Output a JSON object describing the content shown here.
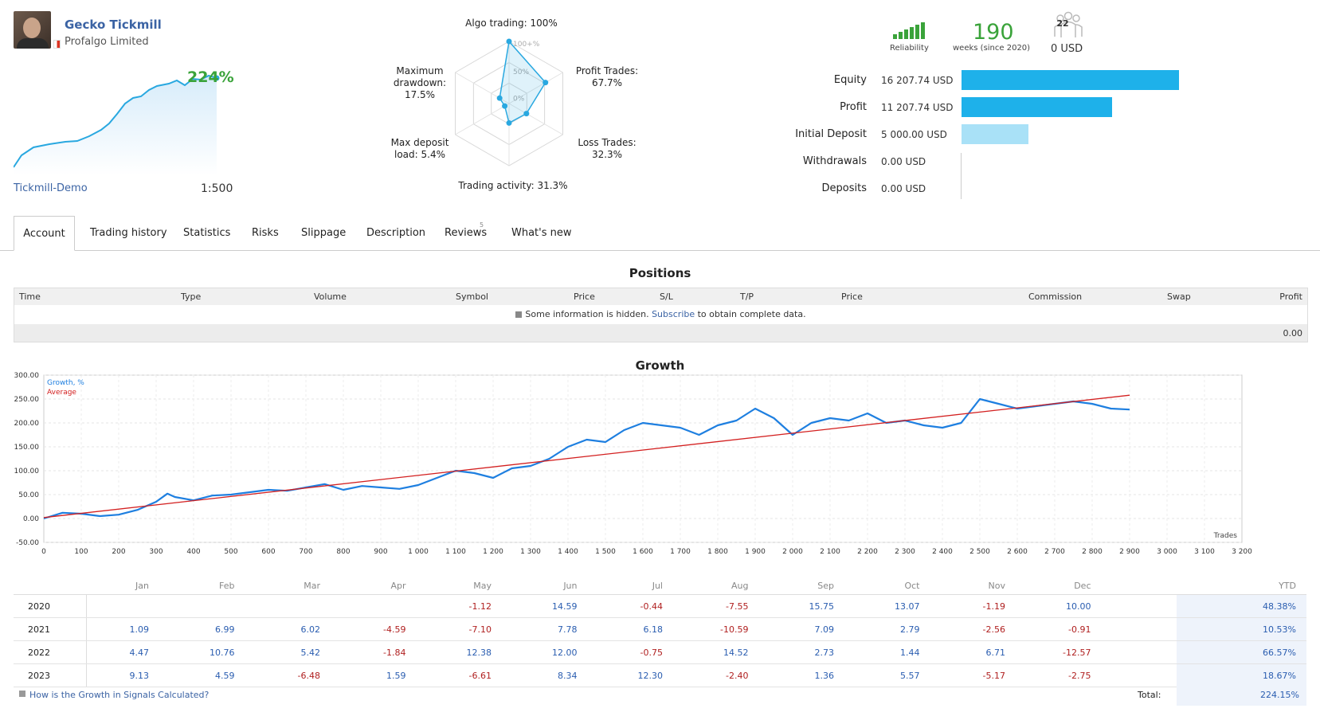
{
  "profile": {
    "name": "Gecko Tickmill",
    "company": "Profalgo Limited",
    "growth": "224%",
    "server": "Tickmill-Demo",
    "leverage": "1:500"
  },
  "radar": {
    "labels": {
      "algo": "Algo trading: 100%",
      "profit_trades": "Profit Trades:\n67.7%",
      "loss_trades": "Loss Trades:\n32.3%",
      "activity": "Trading activity: 31.3%",
      "deposit_load": "Max deposit\nload: 5.4%",
      "drawdown": "Maximum\ndrawdown:\n17.5%"
    },
    "scale": [
      "100+%",
      "50%",
      "0%"
    ],
    "values": {
      "algo": 100,
      "profit_trades": 67.7,
      "loss_trades": 32.3,
      "activity": 31.3,
      "deposit_load": 5.4,
      "drawdown": 17.5
    }
  },
  "summary": {
    "reliability_label": "Reliability",
    "reliability_level": 5,
    "weeks": "190",
    "weeks_label": "weeks (since 2020)",
    "subscribers": "22",
    "subscription_price": "0 USD"
  },
  "stats": [
    {
      "label": "Equity",
      "value": "16 207.74 USD",
      "amount": 16207.74,
      "color": "#1eb1ea"
    },
    {
      "label": "Profit",
      "value": "11 207.74 USD",
      "amount": 11207.74,
      "color": "#1eb1ea"
    },
    {
      "label": "Initial Deposit",
      "value": "5 000.00 USD",
      "amount": 5000,
      "color": "#a9e1f7"
    },
    {
      "label": "Withdrawals",
      "value": "0.00 USD",
      "amount": 0,
      "color": "#1eb1ea"
    },
    {
      "label": "Deposits",
      "value": "0.00 USD",
      "amount": 0,
      "color": "#1eb1ea"
    }
  ],
  "tabs": [
    "Account",
    "Trading history",
    "Statistics",
    "Risks",
    "Slippage",
    "Description",
    "Reviews",
    "What's new"
  ],
  "reviews_count": "5",
  "positions": {
    "title": "Positions",
    "columns": [
      "Time",
      "Type",
      "Volume",
      "Symbol",
      "Price",
      "S/L",
      "T/P",
      "Price",
      "Commission",
      "Swap",
      "Profit"
    ],
    "hidden_text_before": "Some information is hidden. ",
    "subscribe_link": "Subscribe",
    "hidden_text_after": " to obtain complete data.",
    "total": "0.00"
  },
  "chart_data": {
    "type": "line",
    "title": "Growth",
    "legend": [
      "Growth, %",
      "Average"
    ],
    "xlabel": "Trades",
    "ylim": [
      -50,
      300
    ],
    "xlim": [
      0,
      3200
    ],
    "yticks": [
      "300.00",
      "250.00",
      "200.00",
      "150.00",
      "100.00",
      "50.00",
      "0.00",
      "-50.00"
    ],
    "xticks": [
      "0",
      "100",
      "200",
      "300",
      "400",
      "500",
      "600",
      "700",
      "800",
      "900",
      "1 000",
      "1 100",
      "1 200",
      "1 300",
      "1 400",
      "1 500",
      "1 600",
      "1 700",
      "1 800",
      "1 900",
      "2 000",
      "2 100",
      "2 200",
      "2 300",
      "2 400",
      "2 500",
      "2 600",
      "2 700",
      "2 800",
      "2 900",
      "3 000",
      "3 100",
      "3 200"
    ],
    "series": [
      {
        "name": "Growth, %",
        "color": "#1e7fe0",
        "x": [
          0,
          50,
          100,
          150,
          200,
          250,
          300,
          330,
          350,
          400,
          450,
          500,
          550,
          600,
          650,
          700,
          750,
          800,
          850,
          900,
          950,
          1000,
          1050,
          1100,
          1150,
          1200,
          1250,
          1300,
          1350,
          1400,
          1450,
          1500,
          1550,
          1600,
          1650,
          1700,
          1750,
          1800,
          1850,
          1900,
          1950,
          2000,
          2050,
          2100,
          2150,
          2200,
          2250,
          2300,
          2350,
          2400,
          2450,
          2500,
          2550,
          2600,
          2650,
          2700,
          2750,
          2800,
          2850,
          2900
        ],
        "y": [
          0,
          12,
          10,
          5,
          8,
          18,
          35,
          52,
          45,
          38,
          48,
          50,
          55,
          60,
          58,
          65,
          72,
          60,
          68,
          65,
          62,
          70,
          85,
          100,
          95,
          85,
          105,
          110,
          125,
          150,
          165,
          160,
          185,
          200,
          195,
          190,
          175,
          195,
          205,
          230,
          210,
          175,
          200,
          210,
          205,
          220,
          200,
          205,
          195,
          190,
          200,
          250,
          240,
          230,
          235,
          240,
          245,
          240,
          230,
          228
        ]
      },
      {
        "name": "Average",
        "color": "#d32020",
        "x": [
          0,
          2900
        ],
        "y": [
          2,
          258
        ]
      }
    ]
  },
  "monthly": {
    "headers": [
      "Jan",
      "Feb",
      "Mar",
      "Apr",
      "May",
      "Jun",
      "Jul",
      "Aug",
      "Sep",
      "Oct",
      "Nov",
      "Dec",
      "YTD"
    ],
    "rows": [
      {
        "year": "2020",
        "values": [
          "",
          "",
          "",
          "",
          "-1.12",
          "14.59",
          "-0.44",
          "-7.55",
          "15.75",
          "13.07",
          "-1.19",
          "10.00",
          "48.38%"
        ]
      },
      {
        "year": "2021",
        "values": [
          "1.09",
          "6.99",
          "6.02",
          "-4.59",
          "-7.10",
          "7.78",
          "6.18",
          "-10.59",
          "7.09",
          "2.79",
          "-2.56",
          "-0.91",
          "10.53%"
        ]
      },
      {
        "year": "2022",
        "values": [
          "4.47",
          "10.76",
          "5.42",
          "-1.84",
          "12.38",
          "12.00",
          "-0.75",
          "14.52",
          "2.73",
          "1.44",
          "6.71",
          "-12.57",
          "66.57%"
        ]
      },
      {
        "year": "2023",
        "values": [
          "9.13",
          "4.59",
          "-6.48",
          "1.59",
          "-6.61",
          "8.34",
          "12.30",
          "-2.40",
          "1.36",
          "5.57",
          "-5.17",
          "-2.75",
          "18.67%"
        ]
      }
    ],
    "help_link": "How is the Growth in Signals Calculated?",
    "total_label": "Total:",
    "total_value": "224.15%"
  }
}
